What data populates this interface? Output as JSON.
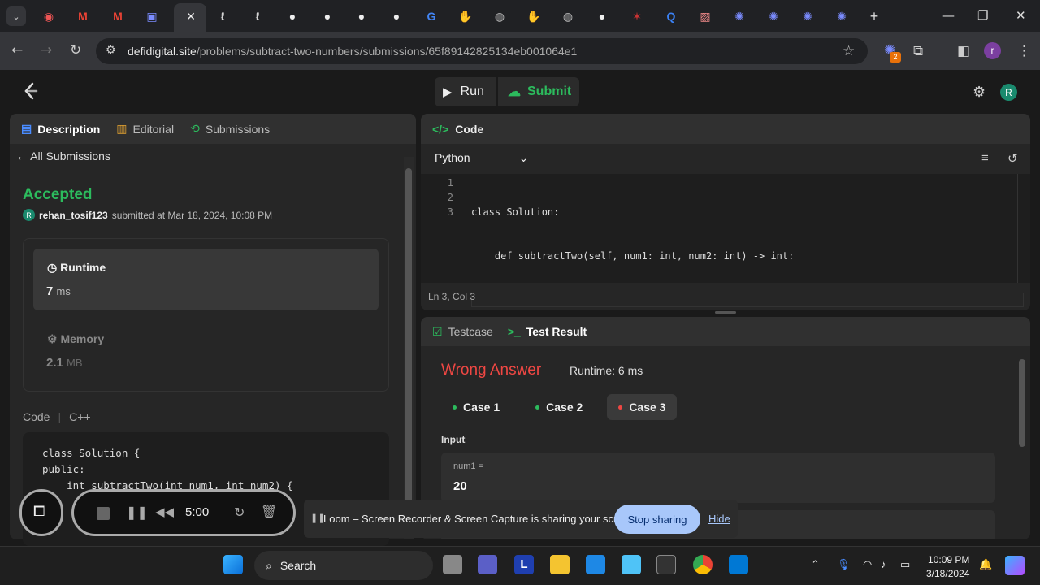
{
  "browser": {
    "url_host": "defidigital.site",
    "url_path": "/problems/subtract-two-numbers/submissions/65f89142825134eb001064e1",
    "extension_badge": "2",
    "profile_initial": "r"
  },
  "header": {
    "run_label": "Run",
    "submit_label": "Submit",
    "avatar_initial": "R"
  },
  "left": {
    "tabs": [
      "Description",
      "Editorial",
      "Submissions"
    ],
    "back_label": "All Submissions",
    "status": "Accepted",
    "user_initial": "R",
    "username": "rehan_tosif123",
    "submitted_text": "submitted at Mar 18, 2024, 10:08 PM",
    "runtime_label": "Runtime",
    "runtime_value": "7",
    "runtime_unit": "ms",
    "memory_label": "Memory",
    "memory_value": "2.1",
    "memory_unit": "MB",
    "code_label": "Code",
    "code_lang": "C++",
    "code_lines": [
      "class Solution {",
      "public:",
      "    int subtractTwo(int num1, int num2) {"
    ]
  },
  "editor": {
    "title": "Code",
    "language": "Python",
    "line_numbers": [
      "1",
      "2",
      "3"
    ],
    "lines": [
      "class Solution:",
      "    def subtractTwo(self, num1: int, num2: int) -> int:",
      ""
    ],
    "cursor": "Ln 3, Col 3"
  },
  "result": {
    "tab_testcase": "Testcase",
    "tab_result": "Test Result",
    "verdict": "Wrong Answer",
    "runtime": "Runtime: 6 ms",
    "cases": [
      {
        "label": "Case 1",
        "color": "#2cbb5d"
      },
      {
        "label": "Case 2",
        "color": "#2cbb5d"
      },
      {
        "label": "Case 3",
        "color": "#ef4743"
      }
    ],
    "input_label": "Input",
    "input_name": "num1 =",
    "input_value": "20"
  },
  "loom": {
    "timer": "5:00",
    "share_message": "Loom – Screen Recorder & Screen Capture is sharing your screen.",
    "stop_label": "Stop sharing",
    "hide_label": "Hide"
  },
  "taskbar": {
    "search_label": "Search",
    "time": "10:09 PM",
    "date": "3/18/2024"
  },
  "colors": {
    "accent_green": "#2cbb5d",
    "accent_red": "#ef4743"
  }
}
